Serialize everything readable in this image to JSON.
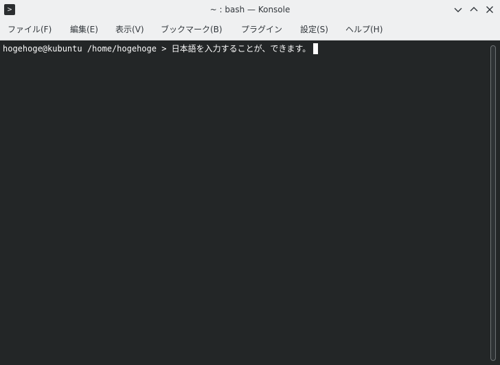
{
  "window": {
    "title": "~ : bash — Konsole",
    "app_icon": "terminal-icon",
    "buttons": [
      "minimize-icon",
      "maximize-icon",
      "close-icon"
    ]
  },
  "menubar": {
    "items": [
      {
        "label": "ファイル(F)"
      },
      {
        "label": "編集(E)"
      },
      {
        "label": "表示(V)"
      },
      {
        "label": "ブックマーク(B)"
      },
      {
        "label": "プラグイン"
      },
      {
        "label": "設定(S)"
      },
      {
        "label": "ヘルプ(H)"
      }
    ]
  },
  "terminal": {
    "prompt": "hogehoge@kubuntu /home/hogehoge > ",
    "input": "日本語を入力することが、できます。"
  },
  "colors": {
    "background": "#232627",
    "foreground": "#fcfcfc",
    "chrome": "#eff0f1"
  }
}
